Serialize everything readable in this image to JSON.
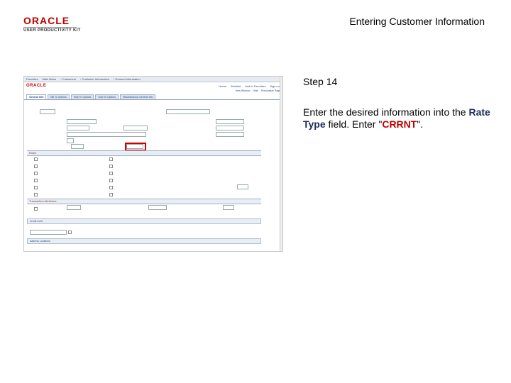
{
  "header": {
    "logo_brand": "ORACLE",
    "logo_product": "USER PRODUCTIVITY KIT",
    "document_title": "Entering Customer Information"
  },
  "step": {
    "title": "Step 14",
    "body_prefix": "Enter the desired information into the ",
    "field_name": "Rate Type",
    "body_middle": " field. Enter \"",
    "value": "CRRNT",
    "body_suffix": "\"."
  },
  "screenshot": {
    "brand": "ORACLE",
    "nav_links": [
      "Home",
      "Worklist",
      "Add to Favorites",
      "Sign out"
    ],
    "tabs": [
      "General Info",
      "Bill To Options",
      "Ship To Options",
      "Sold To Options",
      "Miscellaneous General Info"
    ],
    "section_roles": "Roles",
    "section_attributes": "Transaction Attributes",
    "section_credit_limit": "Credit Limit",
    "section_addresses": "Address Locations"
  },
  "colors": {
    "oracle_red": "#c00000",
    "field_blue": "#1f2d5a",
    "highlight_red": "#d00000"
  }
}
